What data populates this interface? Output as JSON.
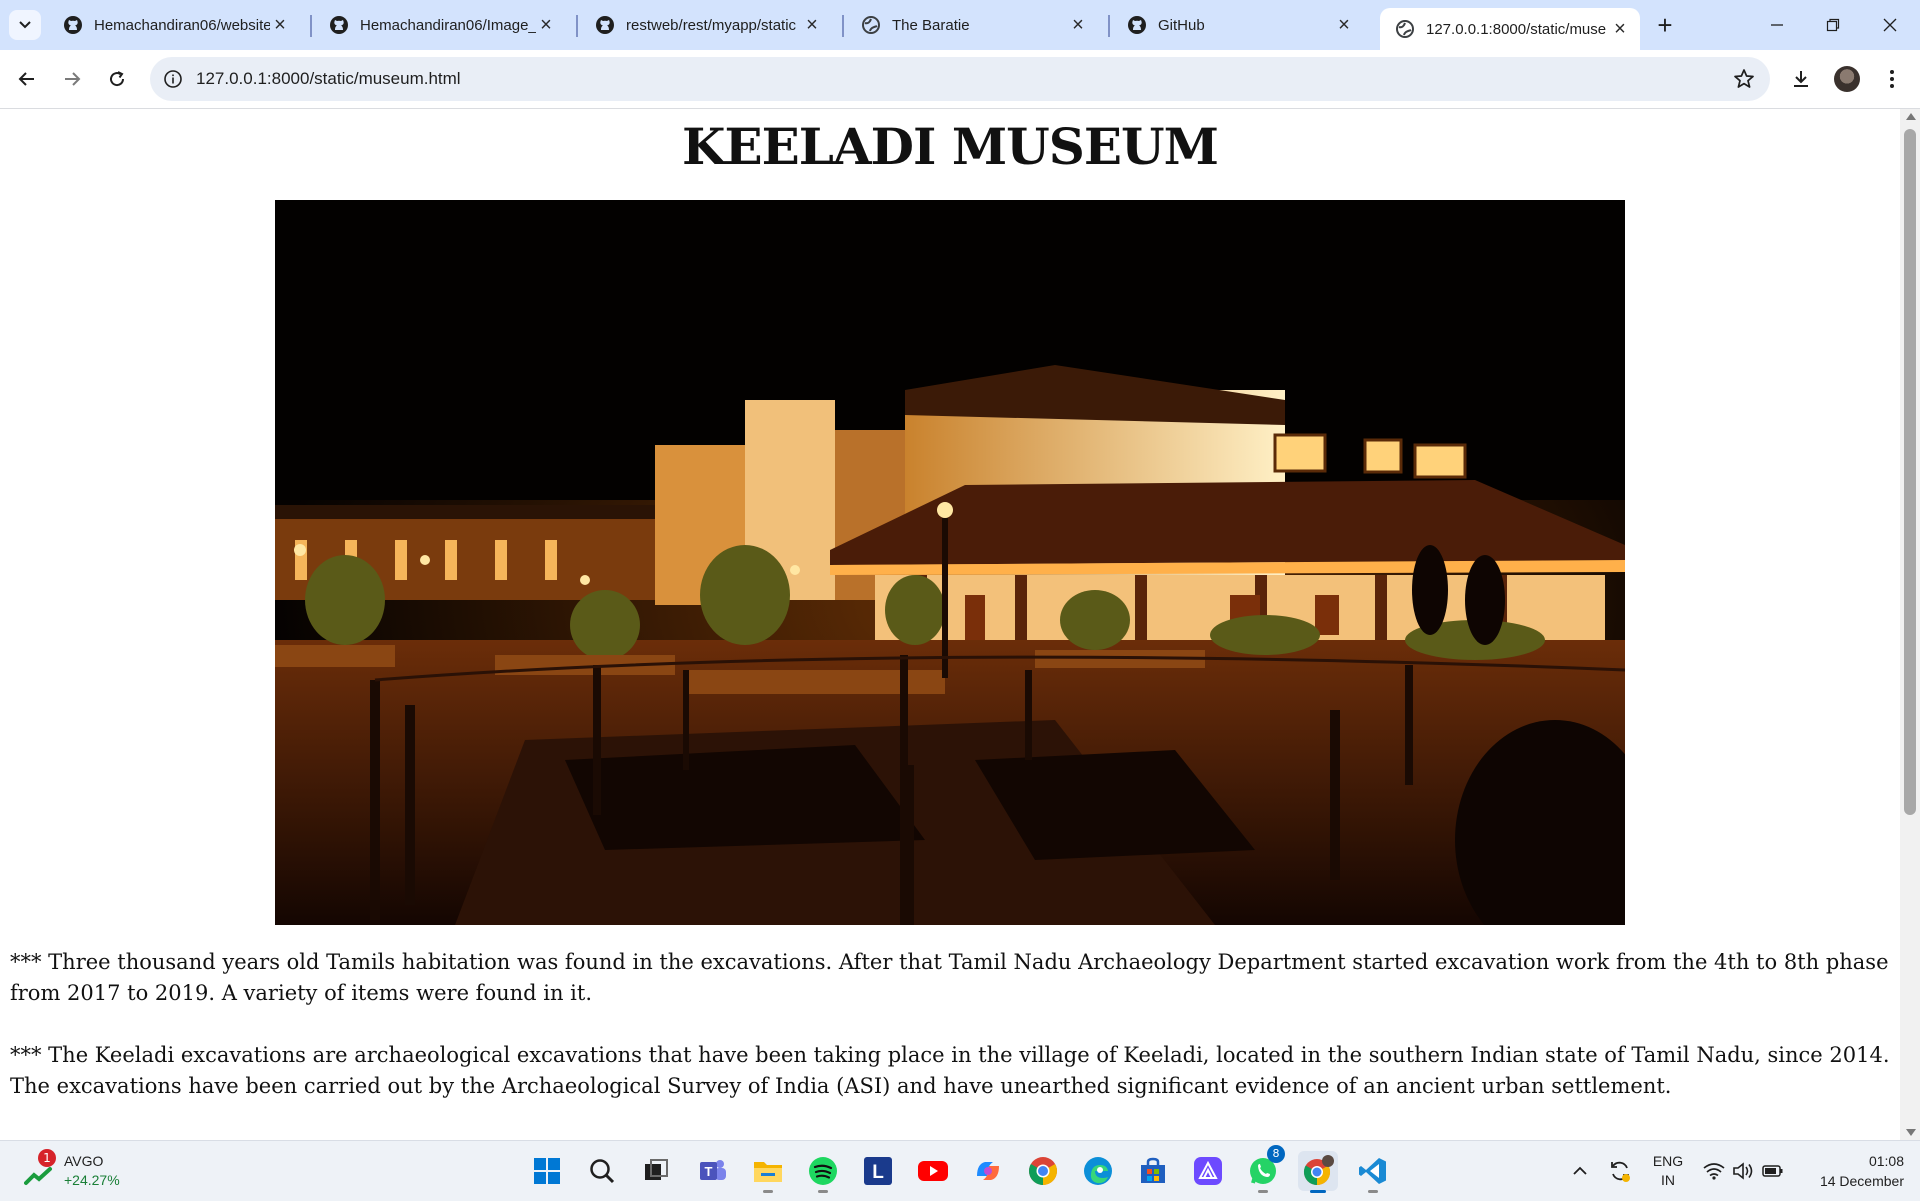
{
  "browser": {
    "tabs": [
      {
        "title": "Hemachandiran06/website",
        "favicon": "github-icon",
        "active": false
      },
      {
        "title": "Hemachandiran06/Image_",
        "favicon": "github-icon",
        "active": false
      },
      {
        "title": "restweb/rest/myapp/static",
        "favicon": "github-icon",
        "active": false
      },
      {
        "title": "The Baratie",
        "favicon": "globe-icon",
        "active": false
      },
      {
        "title": "GitHub",
        "favicon": "github-icon",
        "active": false
      },
      {
        "title": "127.0.0.1:8000/static/muse",
        "favicon": "globe-icon",
        "active": true
      }
    ],
    "url": "127.0.0.1:8000/static/museum.html"
  },
  "page": {
    "heading": "KEELADI MUSEUM",
    "image_subject": "museum-night-photo",
    "paragraphs": [
      "*** Three thousand years old Tamils habitation was found in the excavations. After that Tamil Nadu Archaeology Department started excavation work from the 4th to 8th phase from 2017 to 2019. A variety of items were found in it.",
      "*** The Keeladi excavations are archaeological excavations that have been taking place in the village of Keeladi, located in the southern Indian state of Tamil Nadu, since 2014. The excavations have been carried out by the Archaeological Survey of India (ASI) and have unearthed significant evidence of an ancient urban settlement."
    ]
  },
  "taskbar": {
    "stock": {
      "ticker": "AVGO",
      "change": "+24.27%",
      "badge": "1"
    },
    "apps": [
      "start-icon",
      "search-icon",
      "task-view-icon",
      "teams-icon",
      "file-explorer-icon",
      "spotify-icon",
      "l-app-icon",
      "youtube-icon",
      "copilot-icon",
      "chrome-icon",
      "edge-icon",
      "store-icon",
      "proton-icon",
      "whatsapp-icon",
      "chrome-profile-icon",
      "vscode-icon"
    ],
    "whatsapp_badge": "8",
    "language": {
      "line1": "ENG",
      "line2": "IN"
    },
    "time": "01:08",
    "date": "14 December"
  },
  "colors": {
    "tabbar": "#d3e3fd",
    "omnibox": "#e9eef6",
    "accent": "#0067c0"
  }
}
